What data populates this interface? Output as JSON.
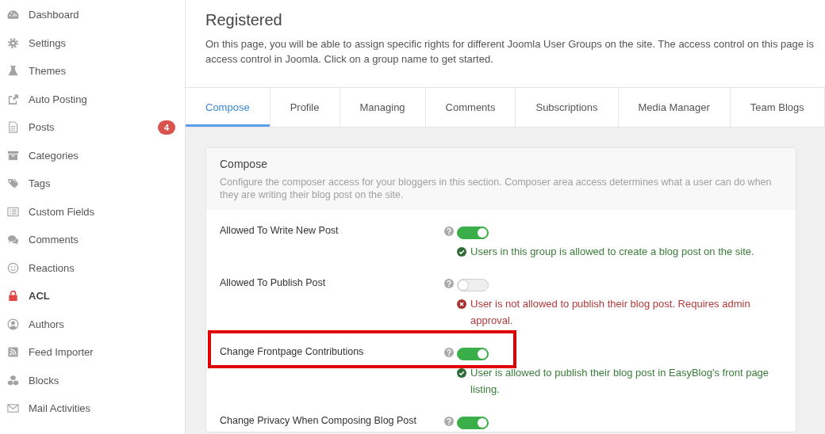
{
  "sidebar": {
    "items": [
      {
        "label": "Dashboard",
        "selected": false
      },
      {
        "label": "Settings",
        "selected": false
      },
      {
        "label": "Themes",
        "selected": false
      },
      {
        "label": "Auto Posting",
        "selected": false
      },
      {
        "label": "Posts",
        "selected": false,
        "badge": "4"
      },
      {
        "label": "Categories",
        "selected": false
      },
      {
        "label": "Tags",
        "selected": false
      },
      {
        "label": "Custom Fields",
        "selected": false
      },
      {
        "label": "Comments",
        "selected": false
      },
      {
        "label": "Reactions",
        "selected": false
      },
      {
        "label": "ACL",
        "selected": true
      },
      {
        "label": "Authors",
        "selected": false
      },
      {
        "label": "Feed Importer",
        "selected": false
      },
      {
        "label": "Blocks",
        "selected": false
      },
      {
        "label": "Mail Activities",
        "selected": false
      }
    ]
  },
  "page": {
    "title": "Registered",
    "description_lines": [
      "On this page, you will be able to assign specific rights for different Joomla User Groups on the site. The access control on this page is",
      "access control in Joomla. Click on a group name to get started."
    ]
  },
  "tabs": [
    {
      "label": "Compose",
      "selected": true
    },
    {
      "label": "Profile",
      "selected": false
    },
    {
      "label": "Managing",
      "selected": false
    },
    {
      "label": "Comments",
      "selected": false
    },
    {
      "label": "Subscriptions",
      "selected": false
    },
    {
      "label": "Media Manager",
      "selected": false
    },
    {
      "label": "Team Blogs",
      "selected": false
    }
  ],
  "panel": {
    "title": "Compose",
    "description": "Configure the composer access for your bloggers in this section. Composer area access determines what a user can do when they are writing their blog post on the site.",
    "rows": [
      {
        "label": "Allowed To Write New Post",
        "on": true,
        "highlighted": false,
        "message": "Users in this group is allowed to create a blog post on the site."
      },
      {
        "label": "Allowed To Publish Post",
        "on": false,
        "highlighted": false,
        "message": "User is not allowed to publish their blog post. Requires admin approval."
      },
      {
        "label": "Change Frontpage Contributions",
        "on": true,
        "highlighted": true,
        "message": "User is allowed to publish their blog post in EasyBlog's front page listing."
      },
      {
        "label": "Change Privacy When Composing Blog Post",
        "on": true,
        "highlighted": false
      }
    ]
  }
}
